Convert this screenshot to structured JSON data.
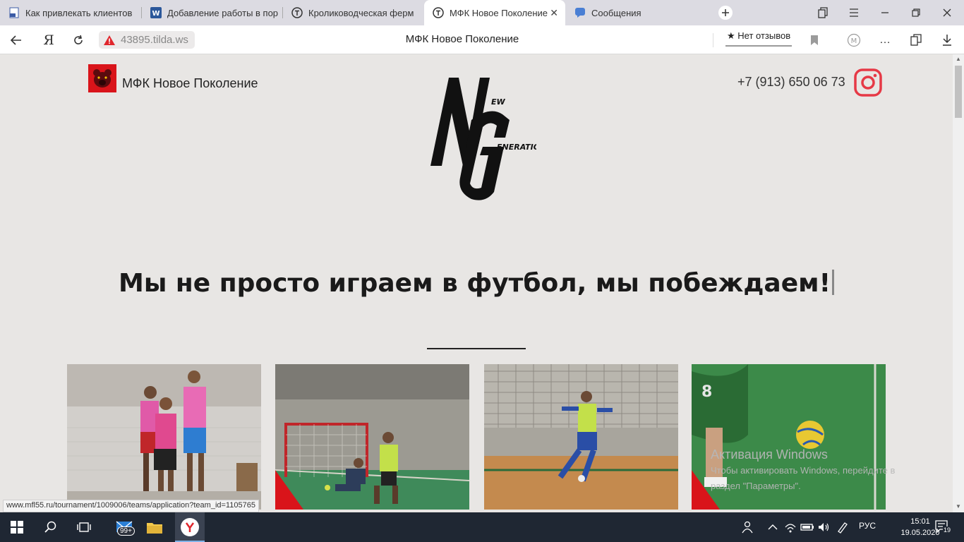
{
  "tabs": [
    {
      "title": "Как привлекать клиентов",
      "icon": "pdf-icon"
    },
    {
      "title": "Добавление работы в пор",
      "icon": "word-icon"
    },
    {
      "title": "Кролиководческая ферм",
      "icon": "tilda-icon"
    },
    {
      "title": "МФК Новое Поколение",
      "icon": "tilda-icon",
      "active": true
    },
    {
      "title": "Сообщения",
      "icon": "messages-icon"
    }
  ],
  "address": {
    "url": "43895.tilda.ws",
    "page_title": "МФК Новое Поколение",
    "reviews": "★ Нет отзывов"
  },
  "site": {
    "brand_name": "МФК Новое Поколение",
    "phone": "+7 (913) 650 06 73",
    "logo_text": {
      "line1": "EW",
      "line2": "ENERATION"
    },
    "headline": "Мы не просто играем в футбол, мы побеждаем!"
  },
  "watermark": {
    "title": "Активация Windows",
    "line1": "Чтобы активировать Windows, перейдите в",
    "line2": "раздел \"Параметры\"."
  },
  "status_url": "www.mfl55.ru/tournament/1009006/teams/application?team_id=1105765",
  "taskbar": {
    "mail_badge": "99+",
    "lang": "РУС",
    "time": "15:01",
    "date": "19.05.2020",
    "notifications": "19"
  },
  "colors": {
    "accent_red": "#e63946",
    "page_bg": "#e8e6e4",
    "taskbar_bg": "#1f2733"
  }
}
